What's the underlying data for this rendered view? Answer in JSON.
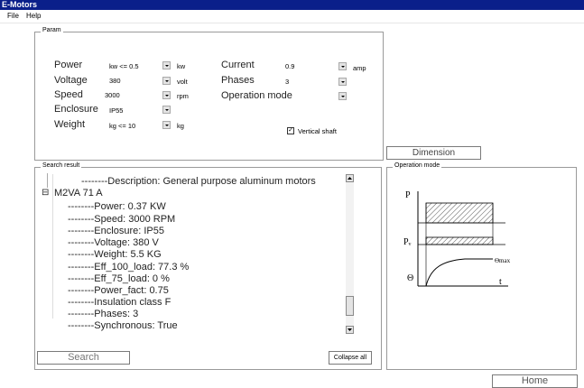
{
  "window": {
    "title": "E-Motors"
  },
  "menu": {
    "file": "File",
    "help": "Help"
  },
  "param": {
    "legend": "Param",
    "power": {
      "label": "Power",
      "value": "kw <= 0.5",
      "unit": "kw"
    },
    "voltage": {
      "label": "Voltage",
      "value": "380",
      "unit": "volt"
    },
    "speed": {
      "label": "Speed",
      "value": "3000",
      "unit": "rpm"
    },
    "enclosure": {
      "label": "Enclosure",
      "value": "IP55"
    },
    "weight": {
      "label": "Weight",
      "value": "kg <= 10",
      "unit": "kg"
    },
    "current": {
      "label": "Current",
      "value": "0.9",
      "unit": "amp"
    },
    "phases": {
      "label": "Phases",
      "value": "3"
    },
    "operation_mode": {
      "label": "Operation mode"
    },
    "vertical_shaft": {
      "label": "Vertical shaft",
      "checked": true
    }
  },
  "dimension_button": "Dimension",
  "search_result": {
    "legend": "Search result",
    "description": "--------Description: General purpose aluminum motors",
    "node_label": "M2VA 71 A",
    "node_toggle": "⊟",
    "children": [
      "--------Power: 0.37 KW",
      "--------Speed: 3000 RPM",
      "--------Enclosure: IP55",
      "--------Voltage: 380 V",
      "--------Weight: 5.5 KG",
      "--------Eff_100_load: 77.3 %",
      "--------Eff_75_load: 0 %",
      "--------Power_fact: 0.75",
      "--------Insulation class F",
      "--------Phases: 3",
      "--------Synchronous: True"
    ]
  },
  "search_button": "Search",
  "collapse_button": "Collapse all",
  "operation_mode_panel": {
    "legend": "Operation mode",
    "p_label": "P",
    "pv_label": "Pᵥ",
    "theta_label": "Θ",
    "theta_max_label": "Θmax",
    "t_label": "t"
  },
  "home_button": "Home"
}
